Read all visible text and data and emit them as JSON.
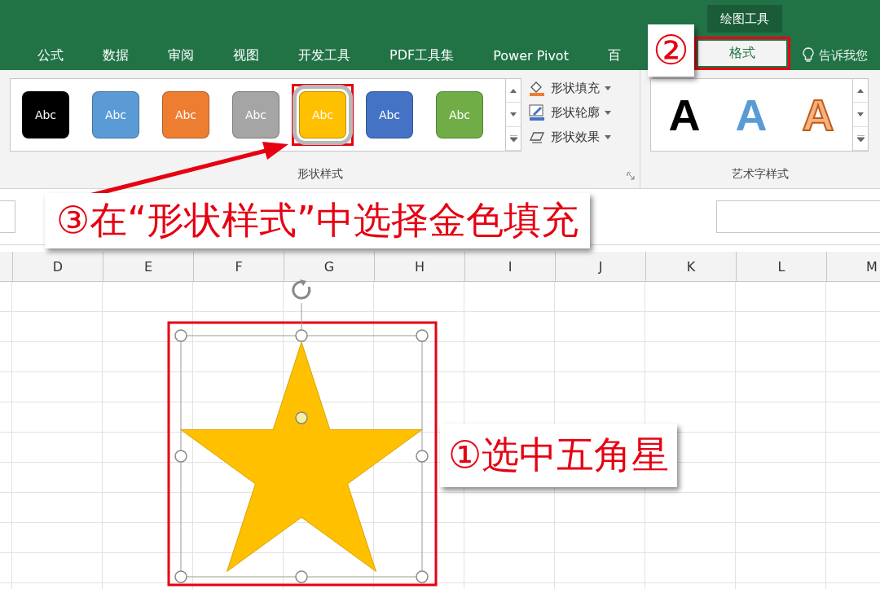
{
  "context_tab_group": {
    "label": "绘图工具"
  },
  "tabs": [
    {
      "label": "公式",
      "selected": false
    },
    {
      "label": "数据",
      "selected": false
    },
    {
      "label": "审阅",
      "selected": false
    },
    {
      "label": "视图",
      "selected": false
    },
    {
      "label": "开发工具",
      "selected": false
    },
    {
      "label": "PDF工具集",
      "selected": false
    },
    {
      "label": "Power Pivot",
      "selected": false
    },
    {
      "label": "百",
      "selected": false
    },
    {
      "label": "格式",
      "selected": true
    }
  ],
  "tell_me": {
    "placeholder": "告诉我您"
  },
  "shape_styles": {
    "swatches": [
      {
        "label": "Abc",
        "color": "#000000",
        "selected": false
      },
      {
        "label": "Abc",
        "color": "#5b9bd5",
        "selected": false
      },
      {
        "label": "Abc",
        "color": "#ed7d31",
        "selected": false
      },
      {
        "label": "Abc",
        "color": "#a5a5a5",
        "selected": false
      },
      {
        "label": "Abc",
        "color": "#ffc000",
        "selected": true
      },
      {
        "label": "Abc",
        "color": "#4472c4",
        "selected": false
      },
      {
        "label": "Abc",
        "color": "#70ad47",
        "selected": false
      }
    ],
    "commands": [
      {
        "label": "形状填充",
        "kind": "fill"
      },
      {
        "label": "形状轮廓",
        "kind": "outline"
      },
      {
        "label": "形状效果",
        "kind": "effect"
      }
    ],
    "group_label": "形状样式"
  },
  "wordart_styles": {
    "samples": [
      {
        "label": "A",
        "kind": "solid"
      },
      {
        "label": "A",
        "kind": "gradient"
      },
      {
        "label": "A",
        "kind": "outline"
      }
    ],
    "group_label": "艺术字样式"
  },
  "columns": [
    "D",
    "E",
    "F",
    "G",
    "H",
    "I",
    "J",
    "K",
    "L",
    "M"
  ],
  "annotations": [
    {
      "text": "②",
      "kind": "tab"
    },
    {
      "text": "③在“形状样式”中选择金色填充",
      "kind": "ribbon"
    },
    {
      "text": "①选中五角星",
      "kind": "shape"
    }
  ]
}
